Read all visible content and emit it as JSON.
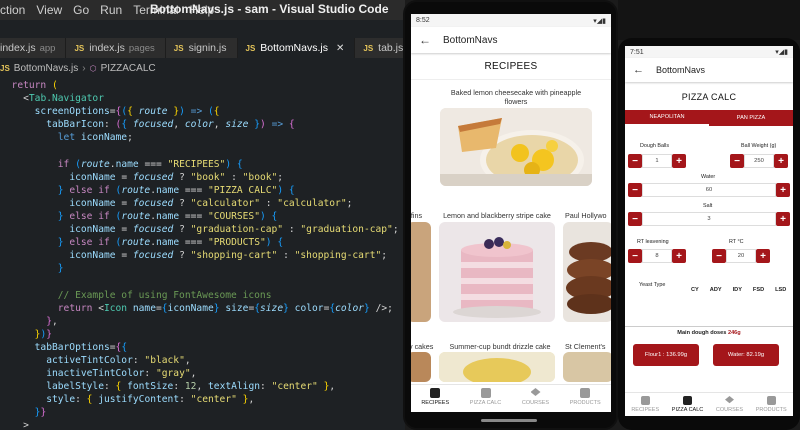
{
  "window": {
    "title": "BottomNavs.js - sam - Visual Studio Code",
    "menu": [
      "ction",
      "View",
      "Go",
      "Run",
      "Terminal",
      "Help"
    ]
  },
  "editor": {
    "tabs": [
      {
        "label": "index.js",
        "sub": "app"
      },
      {
        "label": "index.js",
        "sub": "pages"
      },
      {
        "label": "signin.js",
        "sub": ""
      },
      {
        "label": "BottomNavs.js",
        "sub": "",
        "active": true
      },
      {
        "label": "tab.js",
        "sub": ""
      }
    ],
    "breadcrumb": [
      "BottomNavs.js",
      "PIZZACALC"
    ],
    "js_badge": "JS",
    "close_glyph": "✕"
  },
  "phone1": {
    "time": "8:52",
    "header_title": "BottomNavs",
    "section_title": "RECIPEES",
    "recipes": [
      "Baked lemon cheesecake with pineapple flowers",
      "Lemon and blackberry stripe cake",
      "Summer-cup bundt drizzle cake",
      "ffins",
      "Paul Hollywo",
      "y cakes",
      "St Clement's"
    ],
    "nav": [
      "RECIPEES",
      "PIZZA CALC",
      "COURSES",
      "PRODUCTS"
    ]
  },
  "phone2": {
    "time": "7:51",
    "header_title": "BottomNavs",
    "section_title": "PIZZA CALC",
    "tabs": [
      "NEAPOLITAN",
      "PAN PIZZA"
    ],
    "fields": {
      "dough_balls": {
        "label": "Dough Balls",
        "value": "1"
      },
      "ball_weight": {
        "label": "Ball Weight (g)",
        "value": "250"
      },
      "water": {
        "label": "Water",
        "value": "60"
      },
      "salt": {
        "label": "Salt",
        "value": "3"
      },
      "rt_leavening": {
        "label": "RT leavening",
        "value": "8"
      },
      "rt_temp": {
        "label": "RT °C",
        "value": "20"
      }
    },
    "yeast_label": "Yeast Type",
    "yeast_types": [
      "CY",
      "ADY",
      "IDY",
      "FSD",
      "LSD"
    ],
    "main_dough_label": "Main dough doses",
    "main_dough_value": "246g",
    "flour_button": "Flour1 : 136.99g",
    "water_button": "Water: 82.19g",
    "nav": [
      "RECIPEES",
      "PIZZA CALC",
      "COURSES",
      "PRODUCTS"
    ]
  },
  "colors": {
    "accent": "#a4161a",
    "editor_bg": "#1e2124"
  }
}
